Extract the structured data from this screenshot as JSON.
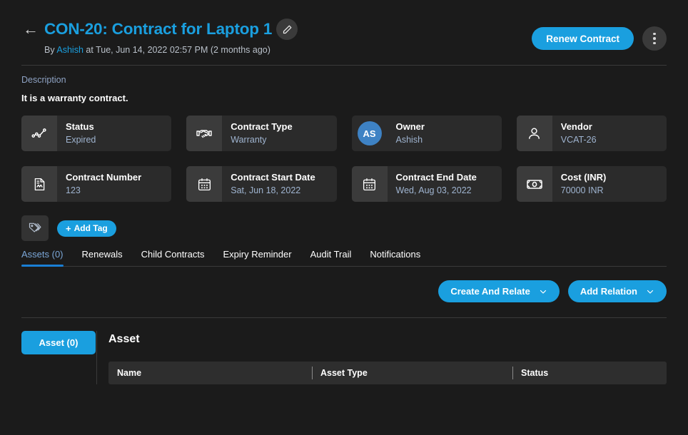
{
  "header": {
    "back_icon": "arrow-left-icon",
    "title": "CON-20: Contract for Laptop 1",
    "edit_icon": "pencil-icon",
    "meta_by": "By",
    "meta_author": "Ashish",
    "meta_rest": "at Tue, Jun 14, 2022 02:57 PM (2 months ago)",
    "renew_label": "Renew Contract",
    "more_icon": "kebab-menu-icon"
  },
  "description": {
    "label": "Description",
    "text": "It is a warranty contract."
  },
  "cards": [
    {
      "icon": "chart-line-icon",
      "label": "Status",
      "value": "Expired"
    },
    {
      "icon": "handshake-icon",
      "label": "Contract Type",
      "value": "Warranty"
    },
    {
      "icon": "avatar",
      "initials": "AS",
      "label": "Owner",
      "value": "Ashish"
    },
    {
      "icon": "user-icon",
      "label": "Vendor",
      "value": "VCAT-26"
    },
    {
      "icon": "document-icon",
      "label": "Contract Number",
      "value": "123"
    },
    {
      "icon": "calendar-icon",
      "label": "Contract Start Date",
      "value": "Sat, Jun 18, 2022"
    },
    {
      "icon": "calendar-icon",
      "label": "Contract End Date",
      "value": "Wed, Aug 03, 2022"
    },
    {
      "icon": "banknote-icon",
      "label": "Cost (INR)",
      "value": "70000 INR"
    }
  ],
  "tags": {
    "icon": "tags-icon",
    "add_plus": "+",
    "add_label": "Add Tag"
  },
  "tabs": [
    {
      "label": "Assets (0)",
      "active": true
    },
    {
      "label": "Renewals",
      "active": false
    },
    {
      "label": "Child Contracts",
      "active": false
    },
    {
      "label": "Expiry Reminder",
      "active": false
    },
    {
      "label": "Audit Trail",
      "active": false
    },
    {
      "label": "Notifications",
      "active": false
    }
  ],
  "relation_actions": [
    {
      "label": "Create And Relate",
      "caret": "chevron-down-icon"
    },
    {
      "label": "Add Relation",
      "caret": "chevron-down-icon"
    }
  ],
  "bottom": {
    "side_pill": "Asset (0)",
    "section_title": "Asset",
    "table": {
      "columns": [
        "Name",
        "Asset Type",
        "Status"
      ],
      "rows": []
    }
  },
  "colors": {
    "accent": "#1a9fdf",
    "avatar": "#3e82c4",
    "background": "#1b1b1b",
    "card": "#2b2b2b",
    "card_icon": "#3b3b3b",
    "value_text": "#9fb4d0"
  }
}
